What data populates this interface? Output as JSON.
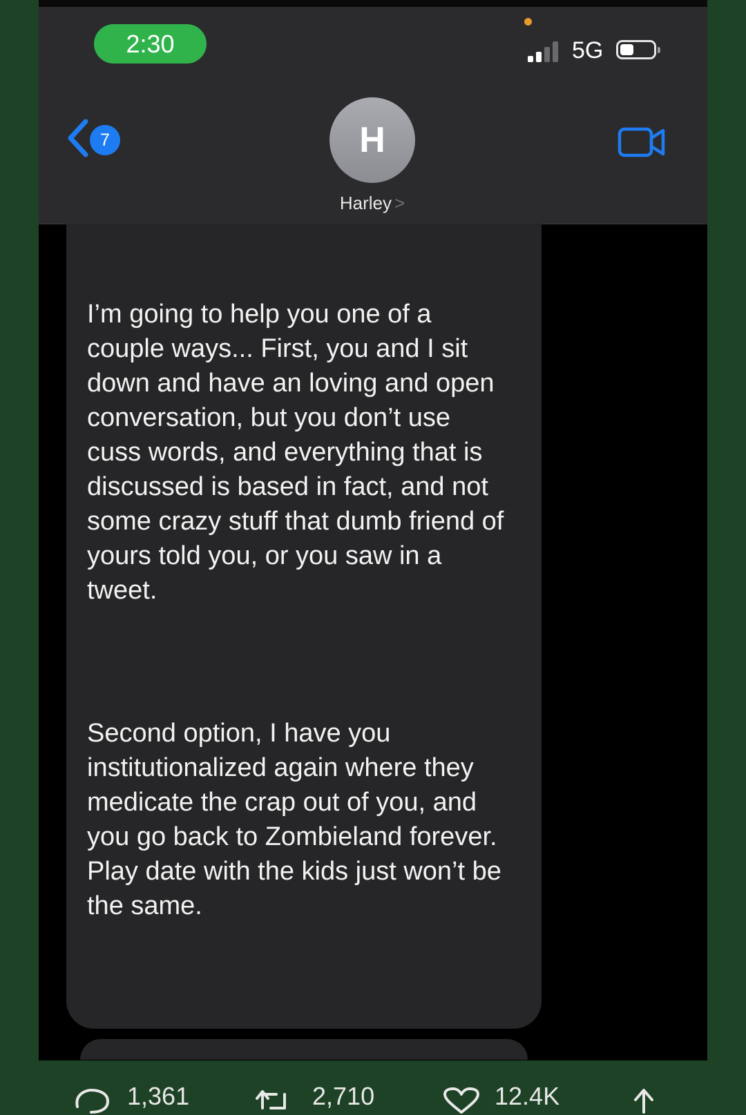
{
  "status_bar": {
    "time": "2:30",
    "network": "5G"
  },
  "nav": {
    "back_badge": "7"
  },
  "contact": {
    "initial": "H",
    "name": "Harley",
    "chevron": ">"
  },
  "messages": [
    {
      "text": "I’m going to help you one of a couple ways... First, you and I sit down and have an loving and open  conversation, but you don’t use cuss words, and everything that is discussed is based in fact, and not some crazy stuff that dumb friend of yours told you, or you saw in a tweet."
    },
    {
      "text": "Second option, I have you institutionalized again where they medicate the crap out of you, and you go back to Zombieland forever. Play date with the kids just won’t be the same."
    }
  ],
  "post_actions": {
    "replies": "1,361",
    "reposts": "2,710",
    "likes": "12.4K"
  },
  "colors": {
    "page_background": "#1e4225",
    "time_pill": "#31b34c",
    "accent_blue": "#1e7cf2",
    "bubble": "#262628",
    "header": "#2b2b2d"
  },
  "icons": [
    "back-chevron-icon",
    "video-call-icon",
    "signal-icon",
    "battery-icon",
    "reply-icon",
    "repost-icon",
    "like-icon",
    "share-icon"
  ]
}
